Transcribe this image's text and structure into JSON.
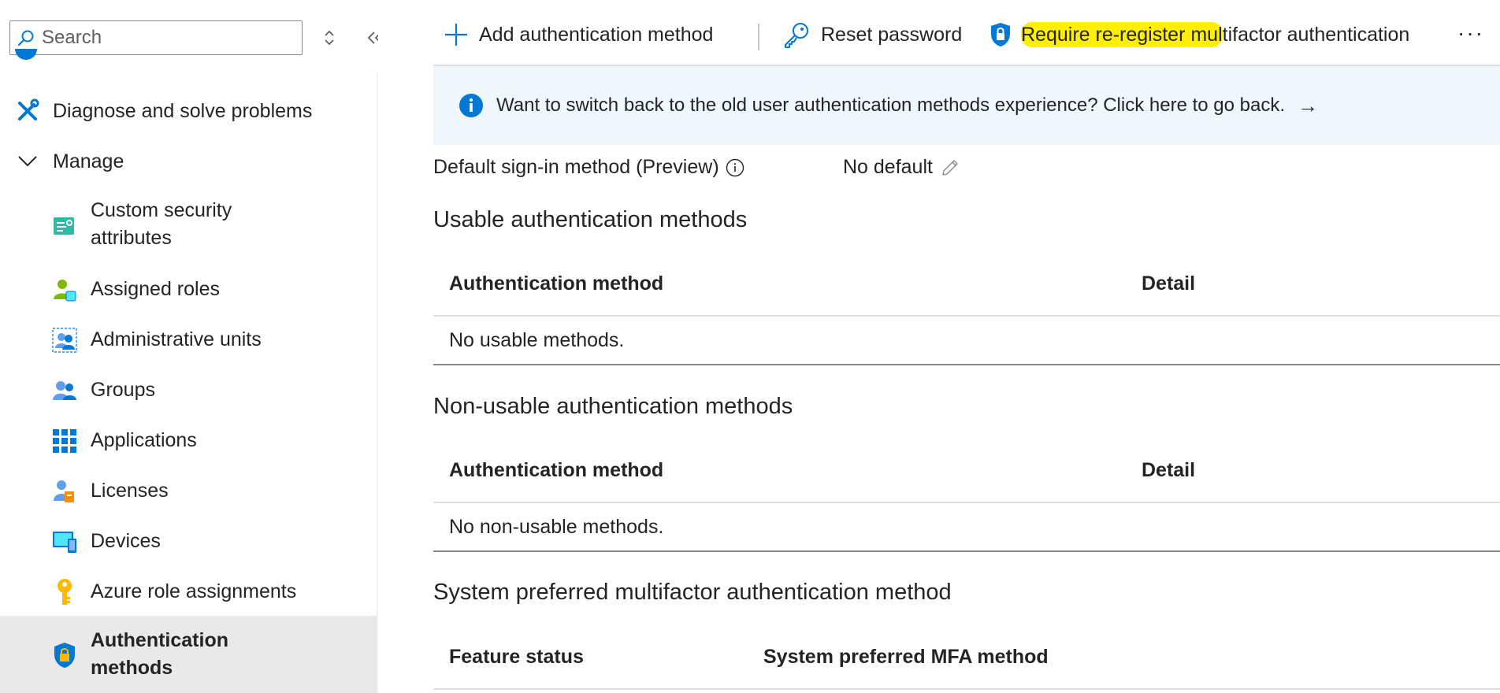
{
  "search": {
    "placeholder": "Search"
  },
  "sidebar": {
    "items": [
      {
        "label": "Diagnose and solve problems",
        "icon": "wrench-screwdriver-icon"
      },
      {
        "label": "Manage",
        "icon": "chevron-down-icon"
      },
      {
        "label": "Custom security attributes",
        "icon": "custom-security-attributes-icon"
      },
      {
        "label": "Assigned roles",
        "icon": "assigned-roles-icon"
      },
      {
        "label": "Administrative units",
        "icon": "administrative-units-icon"
      },
      {
        "label": "Groups",
        "icon": "groups-icon"
      },
      {
        "label": "Applications",
        "icon": "applications-grid-icon"
      },
      {
        "label": "Licenses",
        "icon": "licenses-icon"
      },
      {
        "label": "Devices",
        "icon": "devices-icon"
      },
      {
        "label": "Azure role assignments",
        "icon": "key-icon"
      },
      {
        "label": "Authentication methods",
        "icon": "shield-lock-icon",
        "active": true
      }
    ]
  },
  "toolbar": {
    "add_label": "Add authentication method",
    "reset_label": "Reset password",
    "require_label_highlighted": "Require re-register mul",
    "require_label_rest": "tifactor authentication",
    "more_label": "···"
  },
  "banner": {
    "text": "Want to switch back to the old user authentication methods experience? Click here to go back.",
    "arrow": "→"
  },
  "default_signin": {
    "label": "Default sign-in method (Preview)",
    "value": "No default"
  },
  "usable": {
    "title": "Usable authentication methods",
    "col1": "Authentication method",
    "col2": "Detail",
    "empty": "No usable methods."
  },
  "nonusable": {
    "title": "Non-usable authentication methods",
    "col1": "Authentication method",
    "col2": "Detail",
    "empty": "No non-usable methods."
  },
  "system_preferred": {
    "title": "System preferred multifactor authentication method",
    "col1": "Feature status",
    "col2": "System preferred MFA method"
  },
  "colors": {
    "accent": "#0078d4",
    "highlight": "#ffef00",
    "banner_bg": "#eff6fc",
    "active_bg": "#e9e9e9"
  }
}
